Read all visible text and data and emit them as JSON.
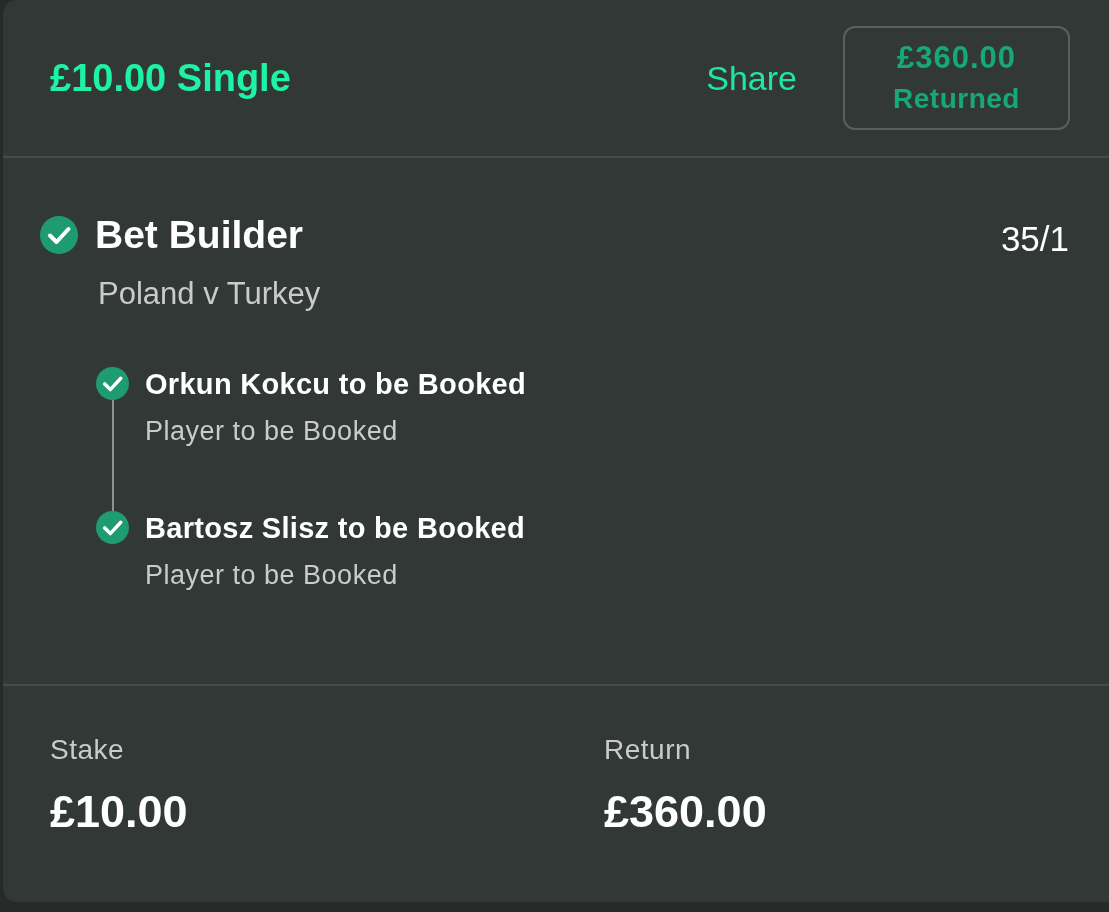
{
  "header": {
    "title": "£10.00 Single",
    "share_label": "Share",
    "returned": {
      "amount": "£360.00",
      "label": "Returned"
    }
  },
  "selection": {
    "won": true,
    "title": "Bet Builder",
    "odds": "35/1",
    "event": "Poland v Turkey",
    "legs": [
      {
        "won": true,
        "title": "Orkun Kokcu to be Booked",
        "market": "Player to be Booked"
      },
      {
        "won": true,
        "title": "Bartosz Slisz to be Booked",
        "market": "Player to be Booked"
      }
    ]
  },
  "summary": [
    {
      "label": "Stake",
      "value": "£10.00"
    },
    {
      "label": "Return",
      "value": "£360.00"
    }
  ]
}
